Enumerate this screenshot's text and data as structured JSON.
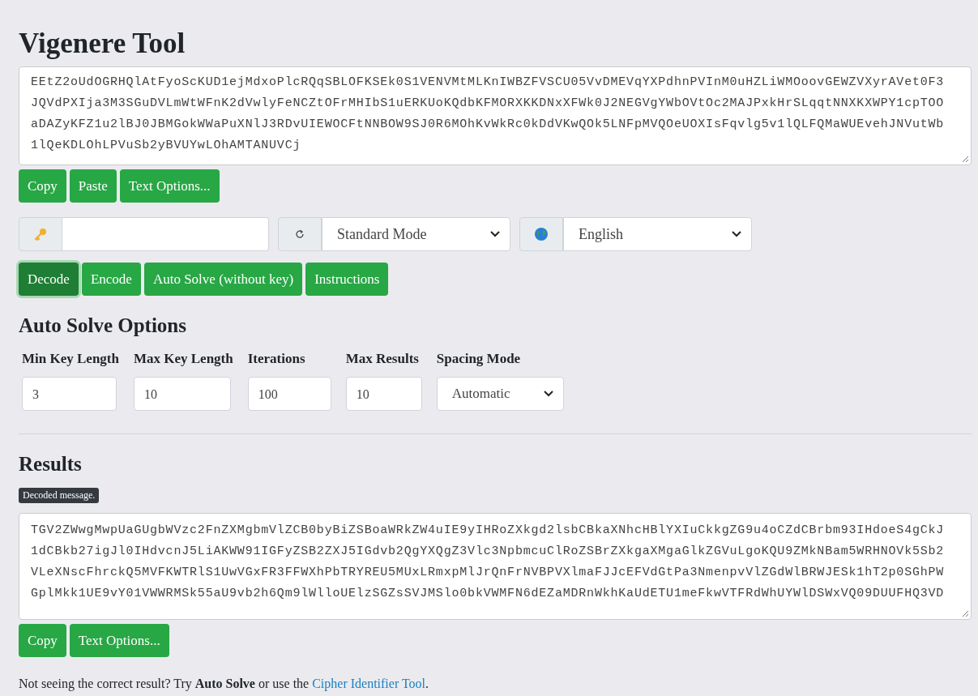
{
  "title": "Vigenere Tool",
  "input": {
    "lines": [
      "EEtZ2oUdOGRHQlAtFyoScKUD1ejMdxoPlcRQqSBLOFKSEk0S1VENVMtMLKnIWBZFVSCU05VvDMEVqYXPdhnPVInM0uHZLiWMOoovGEWZVXyrAVet0F3",
      "JQVdPXIja3M3SGuDVLmWtWFnK2dVwlyFeNCZtOFrMHIbS1uERKUoKQdbKFMORXKKDNxXFWk0J2NEGVgYWbOVtOc2MAJPxkHrSLqqtNNXKXWPY1cpTOO",
      "aDAZyKFZ1u2lBJ0JBMGokWWaPuXNlJ3RDvUIEWOCFtNNBOW9SJ0R6MOhKvWkRc0kDdVKwQOk5LNFpMVQOeUOXIsFqvlg5v1lQLFQMaWUEvehJNVutWb",
      "1lQeKDLOhLPVuSb2yBVUYwLOhAMTANUVCj"
    ]
  },
  "input_buttons": [
    "Copy",
    "Paste",
    "Text Options..."
  ],
  "mode_select": {
    "value": "Standard Mode"
  },
  "language_select": {
    "value": "English"
  },
  "actions": [
    {
      "label": "Decode",
      "selected": true
    },
    {
      "label": "Encode",
      "selected": false
    },
    {
      "label": "Auto Solve (without key)",
      "selected": false
    },
    {
      "label": "Instructions",
      "selected": false
    }
  ],
  "auto_solve": {
    "heading": "Auto Solve Options",
    "fields": [
      {
        "label": "Min Key Length",
        "value": "3",
        "kind": "input"
      },
      {
        "label": "Max Key Length",
        "value": "10",
        "kind": "input"
      },
      {
        "label": "Iterations",
        "value": "100",
        "kind": "input"
      },
      {
        "label": "Max Results",
        "value": "10",
        "kind": "input"
      },
      {
        "label": "Spacing Mode",
        "value": "Automatic",
        "kind": "select"
      }
    ]
  },
  "results": {
    "heading": "Results",
    "badge": "Decoded message.",
    "lines": [
      "TGV2ZWwgMwpUaGUgbWVzc2FnZXMgbmVlZCB0byBiZSBoaWRkZW4uIE9yIHRoZXkgd2lsbCBkaXNhcHBlYXIuCkkgZG9u4oCZdCBrbm93IHdoeS4gCkJ",
      "1dCBkb27igJl0IHdvcnJ5LiAKWW91IGFyZSB2ZXJ5IGdvb2QgYXQgZ3Vlc3NpbmcuClRoZSBrZXkgaXMgaGlkZGVuLgoKQU9ZMkNBam5WRHNOVk5Sb2",
      "VLeXNscFhrckQ5MVFKWTRlS1UwVGxFR3FFWXhPbTRYREU5MUxLRmxpMlJrQnFrNVBPVXlmaFJJcEFVdGtPa3NmenpvVlZGdWlBRWJESk1hT2p0SGhPW",
      "GplMkk1UE9vY01VWWRMSk55aU9vb2h6Qm9lWlloUElzSGZsSVJMSlo0bkVWMFN6dEZaMDRnWkhKaUdETU1meFkwVTFRdWhUYWlDSWxVQ09DUUFHQ3VD"
    ],
    "buttons": [
      "Copy",
      "Text Options..."
    ]
  },
  "footer": {
    "text": "Not seeing the correct result? Try **Auto Solve** or use the",
    "link": "Cipher Identifier Tool",
    "end": "."
  }
}
